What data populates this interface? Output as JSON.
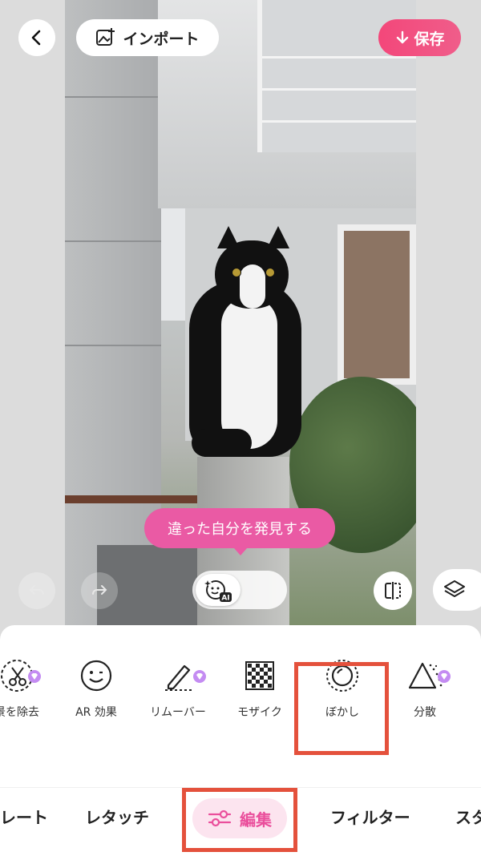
{
  "header": {
    "import_label": "インポート",
    "save_label": "保存"
  },
  "canvas": {
    "tooltip": "違った自分を発見する",
    "ai_badge": "AI"
  },
  "tools": [
    {
      "label": "景を除去",
      "icon": "scissors-circle-icon",
      "premium": true
    },
    {
      "label": "AR 効果",
      "icon": "smiley-face-icon",
      "premium": false
    },
    {
      "label": "リムーバー",
      "icon": "eraser-pen-icon",
      "premium": true
    },
    {
      "label": "モザイク",
      "icon": "mosaic-checker-icon",
      "premium": false
    },
    {
      "label": "ぼかし",
      "icon": "blur-circle-icon",
      "premium": false
    },
    {
      "label": "分散",
      "icon": "triangle-dispersion-icon",
      "premium": true
    }
  ],
  "tabs": [
    {
      "label": "レート"
    },
    {
      "label": "レタッチ"
    },
    {
      "label": "編集",
      "active": true
    },
    {
      "label": "フィルター"
    },
    {
      "label": "スタ"
    }
  ],
  "colors": {
    "accent_pink": "#ea4f9c",
    "save_gradient_start": "#f3477a",
    "highlight_red": "#e4513c"
  }
}
